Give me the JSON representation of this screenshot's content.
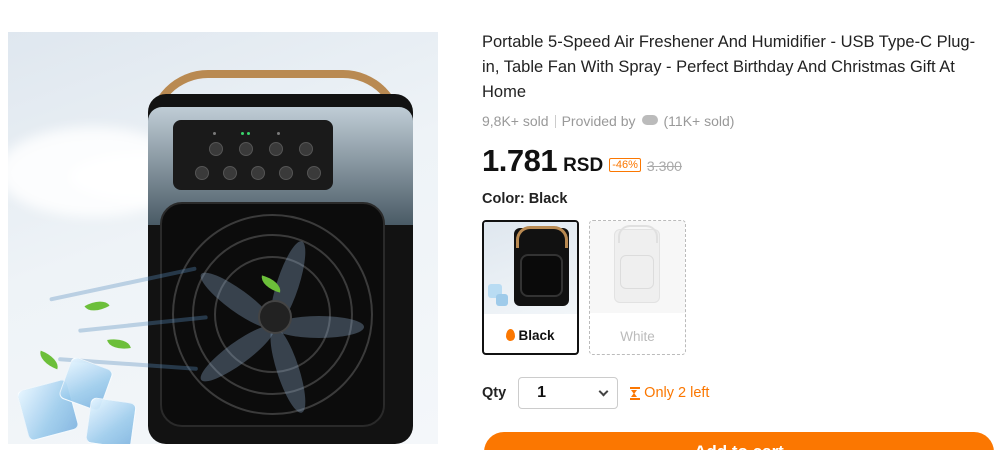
{
  "product": {
    "title": "Portable 5-Speed Air Freshener And Humidifier - USB Type-C Plug-in, Table Fan With Spray - Perfect Birthday And Christmas Gift At Home",
    "sold": "9,8K+ sold",
    "provided_by": "Provided by",
    "provider_sold": "(11K+ sold)",
    "price": "1.781",
    "currency": "RSD",
    "discount": "-46%",
    "old_price": "3.300",
    "image_icon": "product-photo-fan"
  },
  "color": {
    "label": "Color: Black",
    "options": [
      {
        "label": "Black",
        "selected": true,
        "available": true,
        "badge_icon": "flame-icon"
      },
      {
        "label": "White",
        "selected": false,
        "available": false
      }
    ]
  },
  "quantity": {
    "label": "Qty",
    "value": "1",
    "stock_text": "Only 2 left",
    "stock_icon": "hourglass-icon"
  },
  "cart": {
    "label": "Add to cart"
  },
  "colors": {
    "accent": "#fb7701",
    "text": "#222222",
    "muted": "#999999"
  }
}
